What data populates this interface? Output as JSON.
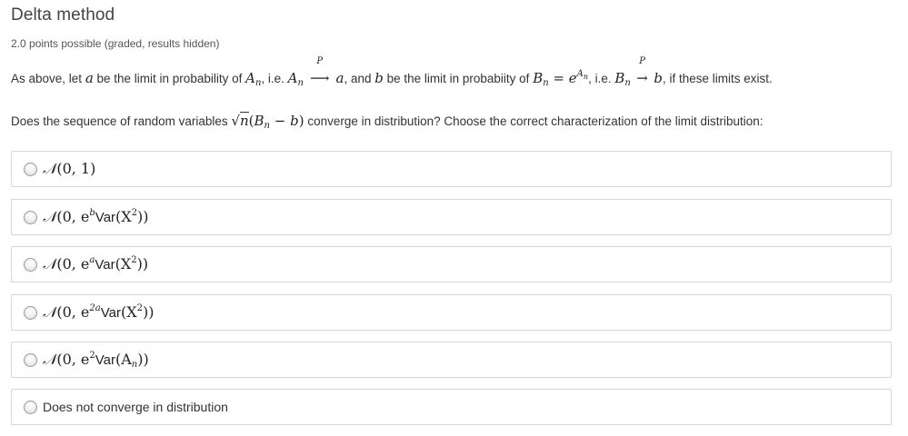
{
  "problem": {
    "title": "Delta method",
    "points": "2.0 points possible (graded, results hidden)"
  },
  "question": {
    "p1": {
      "t1": "As above, let ",
      "a": "a",
      "t2": " be the limit in probability of ",
      "An": "A",
      "n": "n",
      "t3": ", i.e. ",
      "arrow_label": "P",
      "t4": ", and ",
      "b": "b",
      "t5": " be the limit in probabiity of ",
      "Bn": "B",
      "eq": " = ",
      "e": "e",
      "t6": ", i.e. ",
      "t7": ", if these limits exist."
    },
    "p2": {
      "t1": "Does the sequence of random variables ",
      "sqrt": "√",
      "n": "n",
      "expr_open": "(",
      "B": "B",
      "minus": " − ",
      "b": "b",
      "expr_close": ")",
      "t2": " converge in distribution? Choose the correct characterization of the limit distribution:"
    }
  },
  "options": [
    {
      "N": "𝒩",
      "body": "(0, 1)"
    },
    {
      "N": "𝒩",
      "pre": "(0, e",
      "sup": "b",
      "var": "Var",
      "post": "(X",
      "sup2": "2",
      "end": "))"
    },
    {
      "N": "𝒩",
      "pre": "(0, e",
      "sup": "a",
      "var": "Var",
      "post": "(X",
      "sup2": "2",
      "end": "))"
    },
    {
      "N": "𝒩",
      "pre": "(0, e",
      "sup": "2a",
      "var": "Var",
      "post": "(X",
      "sup2": "2",
      "end": "))"
    },
    {
      "N": "𝒩",
      "pre": "(0, e",
      "sup": "2",
      "var": "Var",
      "post": "(A",
      "sub": "n",
      "end": "))"
    },
    {
      "label": "Does not converge in distribution"
    }
  ]
}
